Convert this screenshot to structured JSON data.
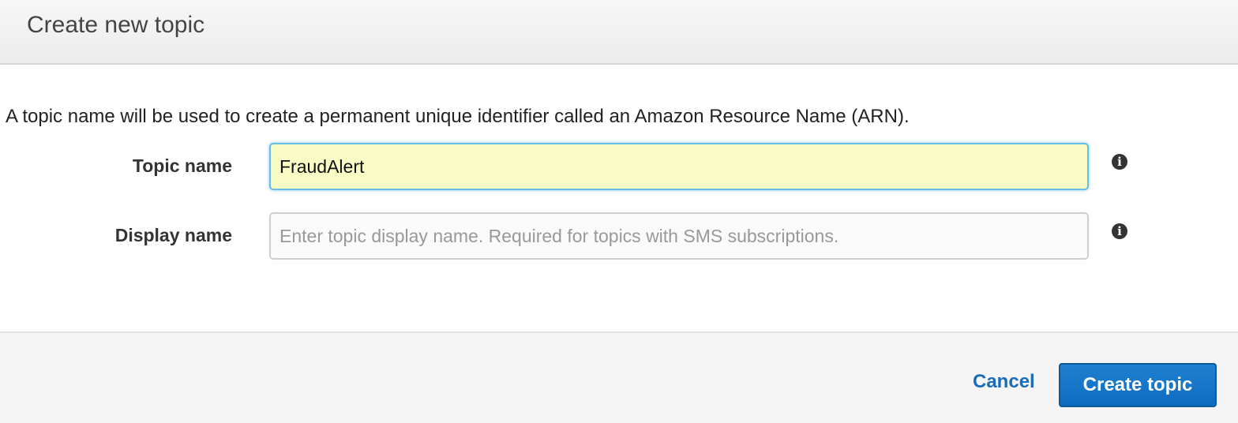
{
  "dialog": {
    "title": "Create new topic",
    "description": "A topic name will be used to create a permanent unique identifier called an Amazon Resource Name (ARN)."
  },
  "form": {
    "topic_name": {
      "label": "Topic name",
      "value": "FraudAlert",
      "info_icon": "info-icon"
    },
    "display_name": {
      "label": "Display name",
      "value": "",
      "placeholder": "Enter topic display name. Required for topics with SMS subscriptions.",
      "info_icon": "info-icon"
    }
  },
  "footer": {
    "cancel_label": "Cancel",
    "create_label": "Create topic"
  },
  "colors": {
    "accent": "#1a6bb8",
    "button": "#1479c9",
    "autofill_background": "#f9fcc4"
  }
}
